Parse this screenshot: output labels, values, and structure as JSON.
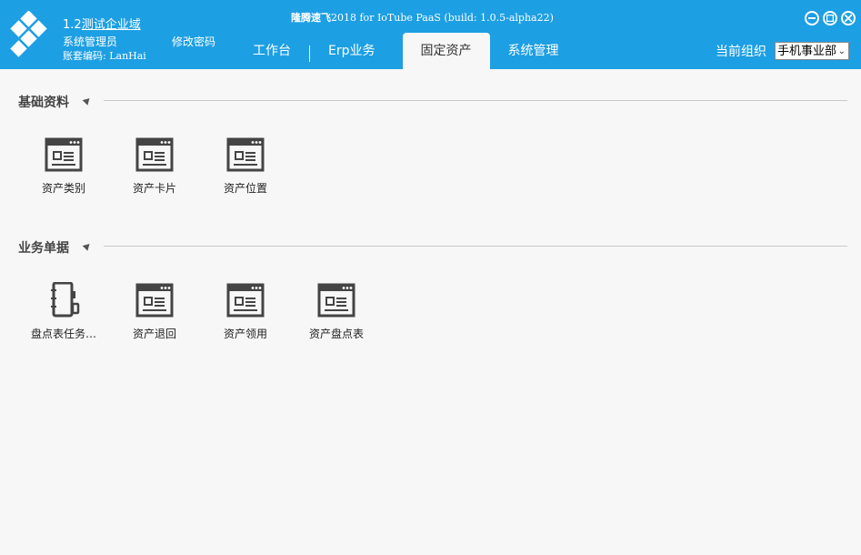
{
  "header": {
    "domain_prefix": "1.2",
    "domain_name": "测试企业域",
    "user_role": "系统管理员",
    "change_password": "修改密码",
    "account_code": "账套编码: LanHai",
    "app_title_brand": "隆腾速飞",
    "app_title_rest": "2018 for IoTube PaaS (build: 1.0.5-alpha22)",
    "tabs": [
      {
        "label": "工作台"
      },
      {
        "label": "Erp业务"
      },
      {
        "label": "固定资产"
      },
      {
        "label": "系统管理"
      }
    ],
    "org_label": "当前组织",
    "org_selected": "手机事业部",
    "colors": {
      "bar": "#1d9fe3"
    }
  },
  "sections": [
    {
      "title": "基础资料",
      "items": [
        {
          "label": "资产类别",
          "icon": "window-form-icon"
        },
        {
          "label": "资产卡片",
          "icon": "window-form-icon"
        },
        {
          "label": "资产位置",
          "icon": "window-form-icon"
        }
      ]
    },
    {
      "title": "业务单据",
      "items": [
        {
          "label": "盘点表任务…",
          "icon": "notebook-icon"
        },
        {
          "label": "资产退回",
          "icon": "window-form-icon"
        },
        {
          "label": "资产领用",
          "icon": "window-form-icon"
        },
        {
          "label": "资产盘点表",
          "icon": "window-form-icon"
        }
      ]
    }
  ]
}
